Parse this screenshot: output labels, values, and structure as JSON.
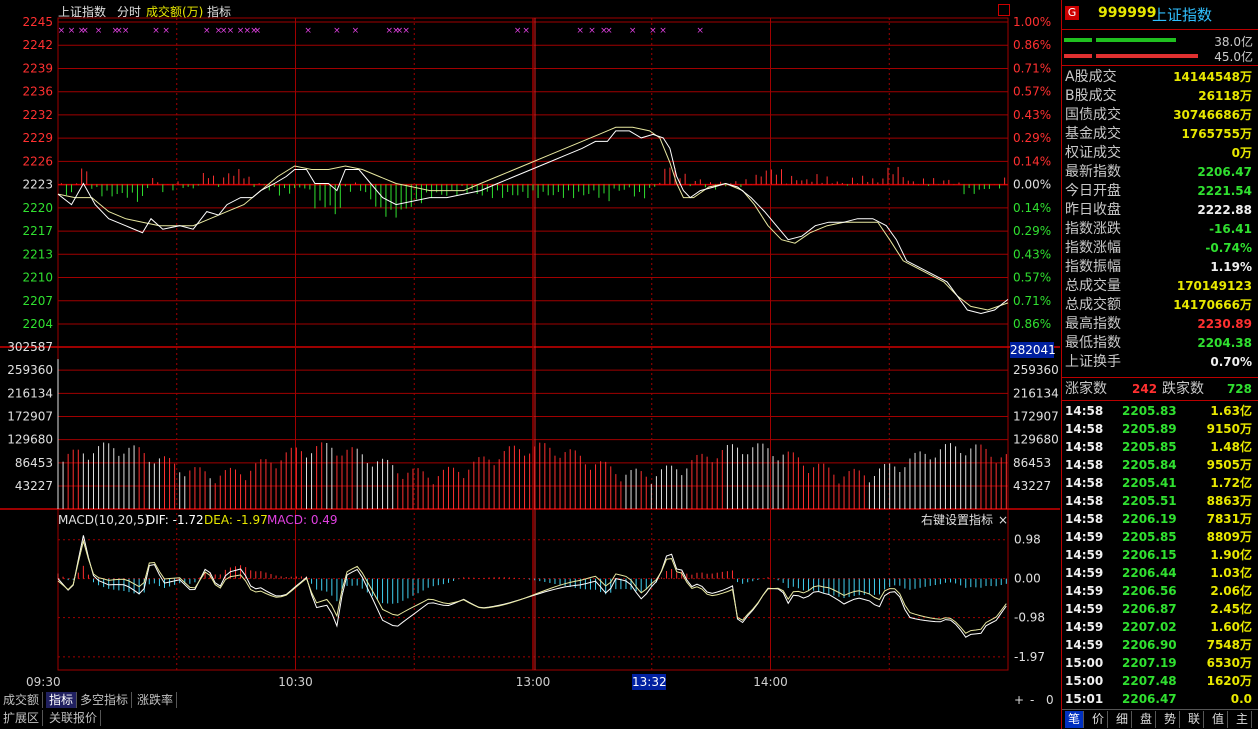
{
  "header": {
    "title": "上证指数",
    "tabs": [
      "分时",
      "成交额(万)",
      "指标"
    ]
  },
  "price_axis": {
    "left_labels": [
      "2245",
      "2242",
      "2239",
      "2236",
      "2232",
      "2229",
      "2226",
      "2223",
      "2220",
      "2217",
      "2213",
      "2210",
      "2207",
      "2204"
    ],
    "right_labels": [
      "1.00%",
      "0.86%",
      "0.71%",
      "0.57%",
      "0.43%",
      "0.29%",
      "0.14%",
      "0.00%",
      "0.14%",
      "0.29%",
      "0.43%",
      "0.57%",
      "0.71%",
      "0.86%"
    ]
  },
  "volume_axis": {
    "labels": [
      "302587",
      "259360",
      "216134",
      "172907",
      "129680",
      "86453",
      "43227"
    ],
    "current": "282041"
  },
  "macd": {
    "params": "MACD(10,20,5)",
    "dif": "DIF: -1.72",
    "dea": "DEA: -1.97",
    "macd": "MACD: 0.49",
    "labels": [
      "0.98",
      "0.00",
      "-0.98",
      "-1.97"
    ],
    "right_hint": "右键设置指标",
    "close": "×"
  },
  "time_axis": {
    "labels": [
      "09:30",
      "10:30",
      "13:00",
      "14:00"
    ],
    "cursor": "13:32"
  },
  "bottom_tabs": [
    "成交额",
    "指标",
    "多空指标",
    "涨跌率"
  ],
  "bottom_tabs2": [
    "扩展区",
    "关联报价"
  ],
  "zoom": {
    "plus": "+",
    "minus": "-",
    "zero": "0"
  },
  "sidebar": {
    "badge": "G",
    "code": "999999",
    "name": "上证指数",
    "bar1_value": "38.0亿",
    "bar2_value": "45.0亿",
    "stats": [
      {
        "label": "A股成交",
        "value": "14144548万"
      },
      {
        "label": "B股成交",
        "value": "26118万"
      },
      {
        "label": "国债成交",
        "value": "30746686万"
      },
      {
        "label": "基金成交",
        "value": "1765755万"
      },
      {
        "label": "权证成交",
        "value": "0万"
      },
      {
        "label": "最新指数",
        "value": "2206.47"
      },
      {
        "label": "今日开盘",
        "value": "2221.54"
      },
      {
        "label": "昨日收盘",
        "value": "2222.88"
      },
      {
        "label": "指数涨跌",
        "value": "-16.41"
      },
      {
        "label": "指数涨幅",
        "value": "-0.74%"
      },
      {
        "label": "指数振幅",
        "value": "1.19%"
      },
      {
        "label": "总成交量",
        "value": "170149123"
      },
      {
        "label": "总成交额",
        "value": "14170666万"
      },
      {
        "label": "最高指数",
        "value": "2230.89"
      },
      {
        "label": "最低指数",
        "value": "2204.38"
      },
      {
        "label": "上证换手",
        "value": "0.70%"
      }
    ],
    "adv_label": "涨家数",
    "adv_value": "242",
    "dec_label": "跌家数",
    "dec_value": "728",
    "ticks": [
      {
        "t": "14:58",
        "p": "2205.83",
        "v": "1.63亿"
      },
      {
        "t": "14:58",
        "p": "2205.89",
        "v": "9150万"
      },
      {
        "t": "14:58",
        "p": "2205.85",
        "v": "1.48亿"
      },
      {
        "t": "14:58",
        "p": "2205.84",
        "v": "9505万"
      },
      {
        "t": "14:58",
        "p": "2205.41",
        "v": "1.72亿"
      },
      {
        "t": "14:58",
        "p": "2205.51",
        "v": "8863万"
      },
      {
        "t": "14:58",
        "p": "2206.19",
        "v": "7831万"
      },
      {
        "t": "14:59",
        "p": "2205.85",
        "v": "8809万"
      },
      {
        "t": "14:59",
        "p": "2206.15",
        "v": "1.90亿"
      },
      {
        "t": "14:59",
        "p": "2206.44",
        "v": "1.03亿"
      },
      {
        "t": "14:59",
        "p": "2206.56",
        "v": "2.06亿"
      },
      {
        "t": "14:59",
        "p": "2206.87",
        "v": "2.45亿"
      },
      {
        "t": "14:59",
        "p": "2207.02",
        "v": "1.60亿"
      },
      {
        "t": "14:59",
        "p": "2206.90",
        "v": "7548万"
      },
      {
        "t": "15:00",
        "p": "2207.19",
        "v": "6530万"
      },
      {
        "t": "15:00",
        "p": "2207.48",
        "v": "1620万"
      },
      {
        "t": "15:01",
        "p": "2206.47",
        "v": "0.0"
      }
    ],
    "bottom_tabs": [
      "笔",
      "价",
      "细",
      "盘",
      "势",
      "联",
      "值",
      "主"
    ]
  },
  "colors": {
    "up": "#ff3030",
    "down": "#30e030",
    "grid": "#a00000",
    "price_line": "#ffffff",
    "avg_line": "#e8e8a0",
    "macd_neg": "#40d0f0"
  },
  "chart_data": {
    "type": "line",
    "prev_close": 2222.88,
    "ylim": [
      2203,
      2246
    ],
    "x_minutes_range": [
      0,
      240
    ],
    "price": [
      [
        0,
        2221.5
      ],
      [
        8,
        2220
      ],
      [
        15,
        2223
      ],
      [
        22,
        2220
      ],
      [
        30,
        2218
      ],
      [
        40,
        2217
      ],
      [
        50,
        2216
      ],
      [
        55,
        2218
      ],
      [
        62,
        2216.5
      ],
      [
        72,
        2217
      ],
      [
        80,
        2216.5
      ],
      [
        88,
        2219
      ],
      [
        95,
        2218.5
      ],
      [
        100,
        2220
      ],
      [
        108,
        2221
      ],
      [
        115,
        2221
      ],
      [
        120,
        2222
      ],
      [
        128,
        2223
      ],
      [
        135,
        2224
      ],
      [
        140,
        2225
      ],
      [
        147,
        2225
      ],
      [
        152,
        2223
      ],
      [
        160,
        2223
      ],
      [
        165,
        2222
      ],
      [
        170,
        2225
      ],
      [
        178,
        2225
      ],
      [
        185,
        2223
      ],
      [
        192,
        2221
      ],
      [
        200,
        2220
      ],
      [
        210,
        2220.5
      ],
      [
        220,
        2221
      ],
      [
        230,
        2221
      ],
      [
        240,
        2221.5
      ],
      [
        250,
        2222
      ],
      [
        260,
        2223
      ],
      [
        270,
        2224
      ],
      [
        280,
        2225
      ],
      [
        290,
        2226
      ],
      [
        300,
        2227
      ],
      [
        310,
        2228
      ],
      [
        318,
        2229
      ],
      [
        325,
        2229
      ],
      [
        330,
        2230.5
      ],
      [
        338,
        2230.5
      ],
      [
        345,
        2229.5
      ],
      [
        352,
        2230
      ],
      [
        358,
        2229.5
      ],
      [
        362,
        2228
      ],
      [
        366,
        2224
      ],
      [
        370,
        2222
      ],
      [
        374,
        2221
      ],
      [
        380,
        2222
      ],
      [
        388,
        2222.5
      ],
      [
        395,
        2223
      ],
      [
        402,
        2222.5
      ],
      [
        410,
        2221
      ],
      [
        418,
        2219
      ],
      [
        425,
        2217
      ],
      [
        432,
        2215
      ],
      [
        440,
        2215.5
      ],
      [
        448,
        2217
      ],
      [
        456,
        2217.5
      ],
      [
        465,
        2217.5
      ],
      [
        473,
        2218
      ],
      [
        482,
        2218
      ],
      [
        490,
        2217
      ],
      [
        496,
        2215
      ],
      [
        502,
        2212
      ],
      [
        510,
        2211
      ],
      [
        518,
        2210
      ],
      [
        526,
        2209
      ],
      [
        532,
        2207
      ],
      [
        538,
        2205
      ],
      [
        546,
        2204.5
      ],
      [
        554,
        2205
      ],
      [
        562,
        2206.5
      ]
    ],
    "avg": [
      [
        0,
        2221.5
      ],
      [
        10,
        2221
      ],
      [
        20,
        2221
      ],
      [
        30,
        2219
      ],
      [
        40,
        2218
      ],
      [
        50,
        2217.5
      ],
      [
        60,
        2217
      ],
      [
        70,
        2217
      ],
      [
        80,
        2217
      ],
      [
        90,
        2218
      ],
      [
        100,
        2219
      ],
      [
        110,
        2220
      ],
      [
        120,
        2222
      ],
      [
        130,
        2224
      ],
      [
        140,
        2225.5
      ],
      [
        150,
        2225
      ],
      [
        160,
        2225
      ],
      [
        170,
        2225.5
      ],
      [
        180,
        2225
      ],
      [
        190,
        2224
      ],
      [
        200,
        2223
      ],
      [
        210,
        2222.5
      ],
      [
        220,
        2222
      ],
      [
        230,
        2222
      ],
      [
        240,
        2222
      ],
      [
        250,
        2223
      ],
      [
        260,
        2224
      ],
      [
        270,
        2225
      ],
      [
        280,
        2226
      ],
      [
        290,
        2227
      ],
      [
        300,
        2228
      ],
      [
        310,
        2229
      ],
      [
        320,
        2230
      ],
      [
        330,
        2231
      ],
      [
        340,
        2231
      ],
      [
        350,
        2230.5
      ],
      [
        356,
        2229.5
      ],
      [
        362,
        2226
      ],
      [
        366,
        2223
      ],
      [
        370,
        2221
      ],
      [
        376,
        2221
      ],
      [
        385,
        2222.5
      ],
      [
        395,
        2223
      ],
      [
        405,
        2222
      ],
      [
        412,
        2220
      ],
      [
        420,
        2217
      ],
      [
        428,
        2215
      ],
      [
        436,
        2214.5
      ],
      [
        445,
        2216
      ],
      [
        455,
        2217
      ],
      [
        465,
        2217.5
      ],
      [
        475,
        2217.5
      ],
      [
        485,
        2217.5
      ],
      [
        492,
        2215
      ],
      [
        500,
        2212
      ],
      [
        508,
        2211
      ],
      [
        516,
        2210
      ],
      [
        524,
        2209
      ],
      [
        532,
        2207
      ],
      [
        540,
        2205.5
      ],
      [
        550,
        2205
      ],
      [
        562,
        2206
      ]
    ],
    "volume_range": [
      0,
      302587
    ],
    "macd_range": [
      -2.3,
      1.3
    ]
  }
}
